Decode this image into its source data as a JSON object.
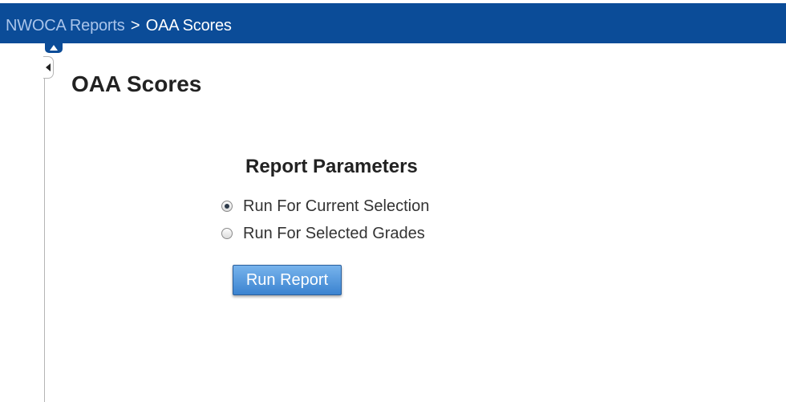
{
  "header": {
    "breadcrumb": {
      "parent": "NWOCA Reports",
      "separator": ">",
      "current": "OAA Scores"
    },
    "background_color": "#0b4c98",
    "parent_link_color": "#a9c4ea"
  },
  "sidebar": {
    "collapse_up_icon": "triangle-up-icon",
    "toggle_icon": "triangle-left-icon"
  },
  "main": {
    "title": "OAA Scores",
    "report_parameters": {
      "heading": "Report Parameters",
      "options": [
        {
          "label": "Run For Current Selection",
          "selected": true
        },
        {
          "label": "Run For Selected Grades",
          "selected": false
        }
      ],
      "run_button_label": "Run Report",
      "run_button_color": "#3b83d0"
    }
  }
}
